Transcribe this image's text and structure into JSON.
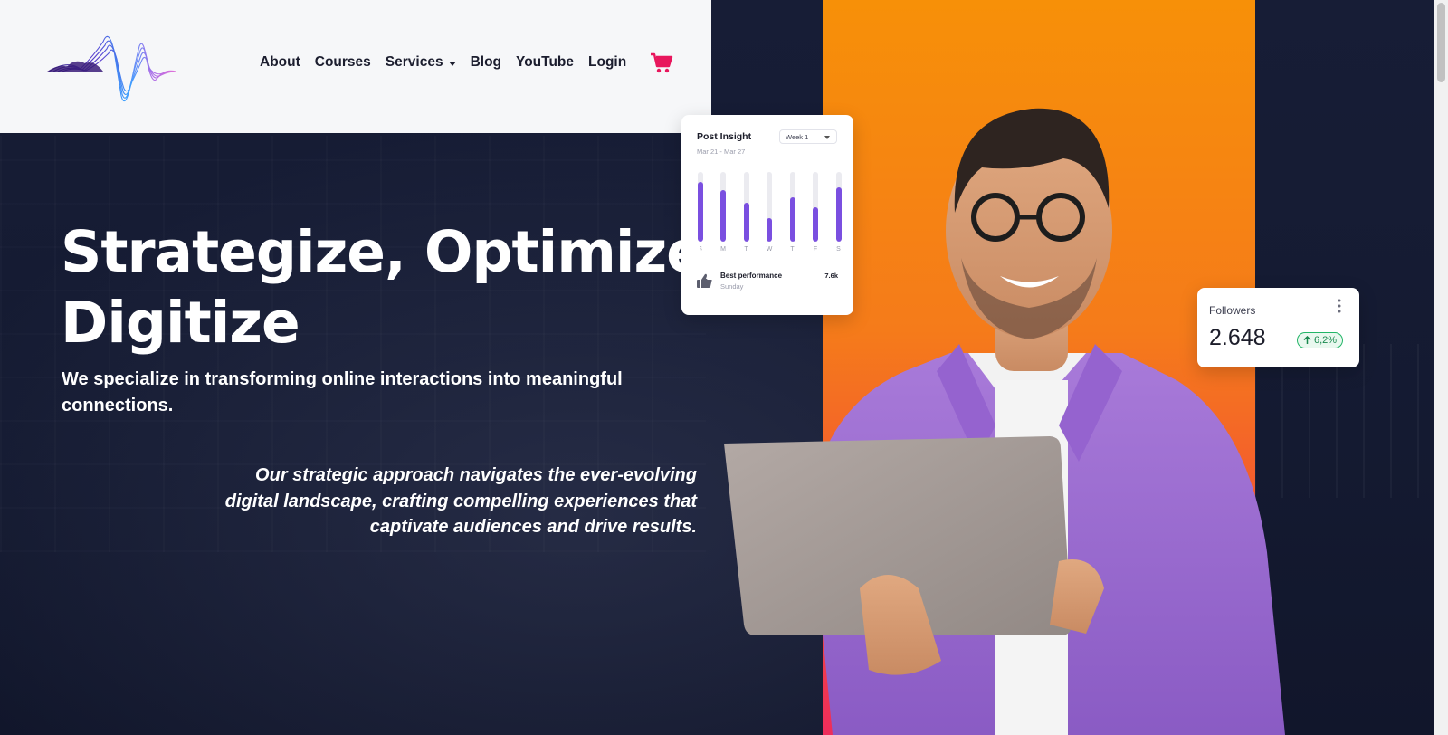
{
  "header": {
    "logo_icon": "waveform-logo-icon",
    "nav": [
      {
        "label": "About"
      },
      {
        "label": "Courses"
      },
      {
        "label": "Services",
        "has_dropdown": true
      },
      {
        "label": "Blog"
      },
      {
        "label": "YouTube"
      },
      {
        "label": "Login"
      }
    ],
    "cart_icon": "shopping-cart-icon",
    "cart_color": "#e8175d"
  },
  "hero": {
    "headline_line1": "Strategize, Optimize,",
    "headline_line2": "Digitize",
    "subhead": "We specialize in transforming online interactions into meaningful connections.",
    "tagline": "Our strategic approach navigates the ever-evolving digital landscape, crafting compelling experiences that captivate audiences and drive results."
  },
  "insight_card": {
    "title": "Post Insight",
    "date_range": "Mar 21 - Mar 27",
    "week_select": "Week 1",
    "accent": "#7a4fe0",
    "bars": [
      {
        "day": "S",
        "fill": 0.86
      },
      {
        "day": "M",
        "fill": 0.74
      },
      {
        "day": "T",
        "fill": 0.56
      },
      {
        "day": "W",
        "fill": 0.34
      },
      {
        "day": "T",
        "fill": 0.64
      },
      {
        "day": "F",
        "fill": 0.49
      },
      {
        "day": "S",
        "fill": 0.78
      }
    ],
    "best_label": "Best performance",
    "best_day": "Sunday",
    "best_value": "7.6k",
    "thumb_icon": "thumbs-up-icon"
  },
  "followers_card": {
    "label": "Followers",
    "value": "2.648",
    "change": "6,2%",
    "change_icon": "arrow-up-icon",
    "more_icon": "more-vertical-icon"
  },
  "colors": {
    "background": "#141a31",
    "orange_top": "#f79008",
    "orange_bottom": "#ee2d5c",
    "shirt": "#9b6bd3"
  }
}
